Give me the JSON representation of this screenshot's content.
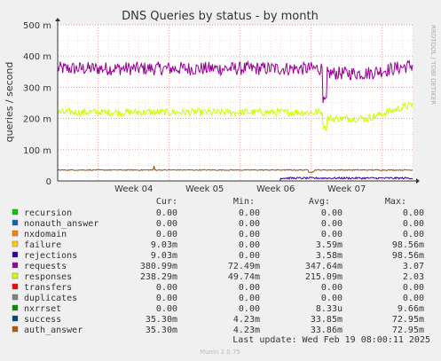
{
  "chart_data": {
    "type": "line",
    "title": "DNS Queries by status - by month",
    "ylabel": "queries / second",
    "side_label": "RRDTOOL / TOBI OETIKER",
    "yticks": [
      {
        "value": 0,
        "label": "0"
      },
      {
        "value": 100,
        "label": "100 m"
      },
      {
        "value": 200,
        "label": "200 m"
      },
      {
        "value": 300,
        "label": "300 m"
      },
      {
        "value": 400,
        "label": "400 m"
      },
      {
        "value": 500,
        "label": "500 m"
      }
    ],
    "ylim": [
      0,
      500
    ],
    "xlim": [
      0,
      35
    ],
    "xticks": [
      {
        "x": 7.5,
        "label": "Week 04"
      },
      {
        "x": 14.5,
        "label": "Week 05"
      },
      {
        "x": 21.5,
        "label": "Week 06"
      },
      {
        "x": 28.5,
        "label": "Week 07"
      }
    ],
    "week_boundaries": [
      4,
      11,
      18,
      25,
      32
    ],
    "grid": true,
    "colors": {
      "requests": "#990099",
      "responses": "#ccff00",
      "auth_answer": "#994c00",
      "rejections": "#330099",
      "failure": "#ffcc00"
    },
    "series": [
      {
        "name": "requests",
        "color": "#990099",
        "baseline": 360,
        "jitter": 22,
        "dip": {
          "x": 26.3,
          "value": 260
        },
        "shift_after": {
          "x": 26.5,
          "delta": -15
        },
        "end_rise": {
          "from": 30.5,
          "to": 370
        }
      },
      {
        "name": "responses",
        "color": "#ccff00",
        "baseline": 220,
        "jitter": 12,
        "dip": {
          "x": 26.3,
          "value": 170
        },
        "shift_after": {
          "x": 26.5,
          "delta": -20
        },
        "end_rise": {
          "from": 30.5,
          "to": 245
        }
      },
      {
        "name": "auth_answer",
        "color": "#994c00",
        "baseline": 35,
        "jitter": 1.5,
        "spike": {
          "x": 9.5,
          "value": 48
        }
      },
      {
        "name": "rejections",
        "color": "#330099",
        "baseline": 0,
        "jitter": 0,
        "step": {
          "from": 22,
          "value": 9,
          "jitter": 3
        }
      }
    ],
    "data_note": "Fluctuating series; approximated"
  },
  "legend": {
    "headers": {
      "cur": "Cur:",
      "min": "Min:",
      "avg": "Avg:",
      "max": "Max:"
    },
    "rows": [
      {
        "name": "recursion",
        "color": "#00cc00",
        "cur": "0.00",
        "min": "0.00",
        "avg": "0.00",
        "max": "0.00"
      },
      {
        "name": "nonauth_answer",
        "color": "#0066b3",
        "cur": "0.00",
        "min": "0.00",
        "avg": "0.00",
        "max": "0.00"
      },
      {
        "name": "nxdomain",
        "color": "#ff8000",
        "cur": "0.00",
        "min": "0.00",
        "avg": "0.00",
        "max": "0.00"
      },
      {
        "name": "failure",
        "color": "#ffcc00",
        "cur": "9.03m",
        "min": "0.00",
        "avg": "3.59m",
        "max": "98.56m"
      },
      {
        "name": "rejections",
        "color": "#330099",
        "cur": "9.03m",
        "min": "0.00",
        "avg": "3.58m",
        "max": "98.56m"
      },
      {
        "name": "requests",
        "color": "#990099",
        "cur": "380.99m",
        "min": "72.49m",
        "avg": "347.64m",
        "max": "3.07"
      },
      {
        "name": "responses",
        "color": "#ccff00",
        "cur": "238.29m",
        "min": "49.74m",
        "avg": "215.09m",
        "max": "2.03"
      },
      {
        "name": "transfers",
        "color": "#ff0000",
        "cur": "0.00",
        "min": "0.00",
        "avg": "0.00",
        "max": "0.00"
      },
      {
        "name": "duplicates",
        "color": "#808080",
        "cur": "0.00",
        "min": "0.00",
        "avg": "0.00",
        "max": "0.00"
      },
      {
        "name": "nxrrset",
        "color": "#008f00",
        "cur": "0.00",
        "min": "0.00",
        "avg": "8.33u",
        "max": "9.66m"
      },
      {
        "name": "success",
        "color": "#00487d",
        "cur": "35.30m",
        "min": "4.23m",
        "avg": "33.85m",
        "max": "72.95m"
      },
      {
        "name": "auth_answer",
        "color": "#b35a00",
        "cur": "35.30m",
        "min": "4.23m",
        "avg": "33.86m",
        "max": "72.95m"
      }
    ]
  },
  "last_update": "Last update: Wed Feb 19 08:00:11 2025",
  "footer": "Munin 2.0.75"
}
